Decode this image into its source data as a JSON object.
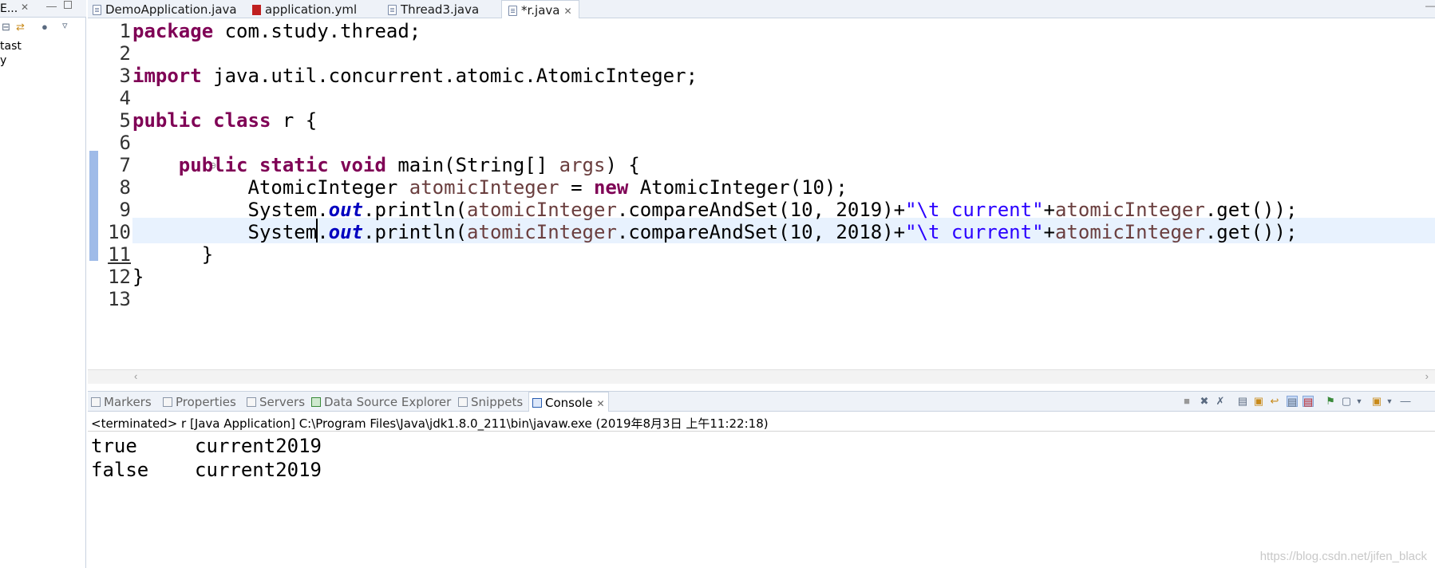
{
  "left_panel": {
    "title": "E...",
    "close": "✕",
    "tree_items": [
      "tast",
      "y"
    ]
  },
  "editor": {
    "tabs": [
      {
        "label": "DemoApplication.java",
        "icon": "java-file-icon"
      },
      {
        "label": "application.yml",
        "icon": "yml-file-icon"
      },
      {
        "label": "Thread3.java",
        "icon": "java-file-icon"
      },
      {
        "label": "*r.java",
        "icon": "java-file-icon",
        "close": "✕"
      }
    ],
    "line_numbers": [
      "1",
      "2",
      "3",
      "4",
      "5",
      "6",
      "7",
      "8",
      "9",
      "10",
      "11",
      "12",
      "13"
    ],
    "current_line": 10,
    "code": {
      "l1_kw": "package",
      "l1_rest": " com.study.thread;",
      "l3_kw": "import",
      "l3_rest": " java.util.concurrent.atomic.AtomicInteger;",
      "l5_kw1": "public",
      "l5_kw2": "class",
      "l5_rest": " r {",
      "l7_indent": "    ",
      "l7_kw1": "public",
      "l7_kw2": "static",
      "l7_kw3": "void",
      "l7_a": " main(String[] ",
      "l7_var": "args",
      "l7_b": ") {",
      "l8_a": "          AtomicInteger ",
      "l8_var": "atomicInteger",
      "l8_b": " = ",
      "l8_kw": "new",
      "l8_c": " AtomicInteger(10);",
      "l9_a": "          System.",
      "l9_fld": "out",
      "l9_b": ".println(",
      "l9_var": "atomicInteger",
      "l9_c": ".compareAndSet(10, 2019)+",
      "l9_str": "\"\\t current\"",
      "l9_d": "+",
      "l9_var2": "atomicInteger",
      "l9_e": ".get());",
      "l10_a": "          System.",
      "l10_fld": "out",
      "l10_b": ".println(",
      "l10_var": "atomicInteger",
      "l10_c": ".compareAndSet(10, 2018)+",
      "l10_str": "\"\\t current\"",
      "l10_d": "+",
      "l10_var2": "atomicInteger",
      "l10_e": ".get());",
      "l11": "      }",
      "l12": "}"
    },
    "fold_marker": "⊖",
    "scroll_left": "‹",
    "scroll_right": "›"
  },
  "views": {
    "tabs": [
      {
        "label": "Markers",
        "icon": "markers-icon"
      },
      {
        "label": "Properties",
        "icon": "properties-icon"
      },
      {
        "label": "Servers",
        "icon": "servers-icon"
      },
      {
        "label": "Data Source Explorer",
        "icon": "data-source-icon"
      },
      {
        "label": "Snippets",
        "icon": "snippets-icon"
      },
      {
        "label": "Console",
        "icon": "console-icon",
        "close": "✕"
      }
    ],
    "toolbar_icons": [
      "terminate-icon",
      "remove-launch-icon",
      "remove-all-icon",
      "clear-console-icon",
      "scroll-lock-icon",
      "word-wrap-icon",
      "show-on-stdout-icon",
      "show-on-stderr-icon",
      "pin-console-icon",
      "display-console-icon",
      "open-console-icon",
      "minimize-icon"
    ]
  },
  "console": {
    "status": "<terminated> r [Java Application] C:\\Program Files\\Java\\jdk1.8.0_211\\bin\\javaw.exe (2019年8月3日 上午11:22:18)",
    "output": [
      "true\tcurrent2019",
      "false\tcurrent2019"
    ],
    "output_display": [
      "true     current2019",
      "false    current2019"
    ]
  },
  "watermark": "https://blog.csdn.net/jifen_black",
  "colors": {
    "keyword": "#7f0055",
    "string": "#2a00ff",
    "field": "#0000c0",
    "local_variable": "#6a3e3e",
    "current_line_bg": "#e8f2fe",
    "change_bar": "#9fbbe8"
  }
}
